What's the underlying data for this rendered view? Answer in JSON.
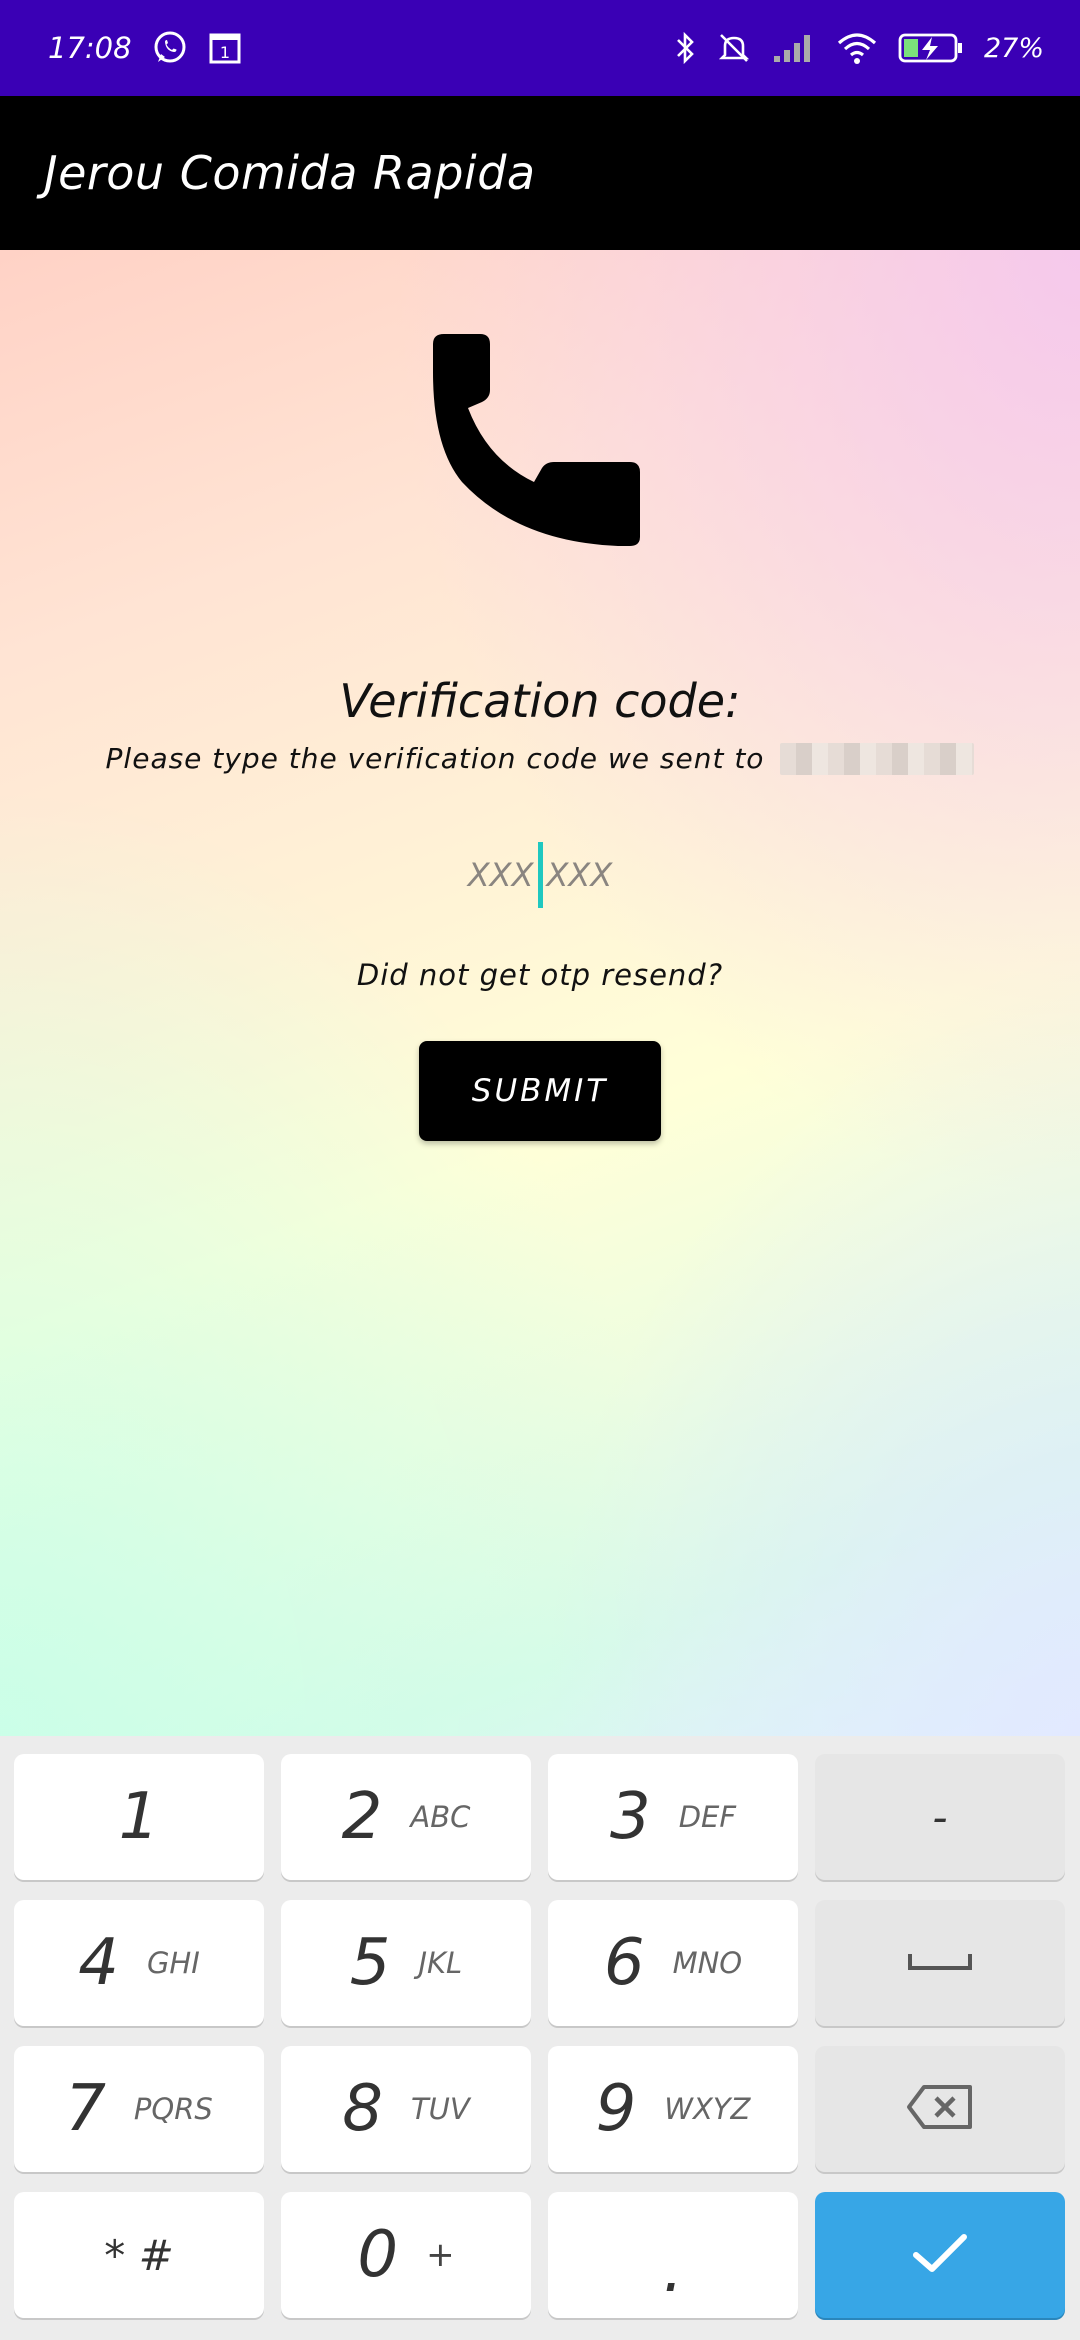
{
  "status_bar": {
    "time": "17:08",
    "battery": "27%",
    "icons": [
      "whatsapp-icon",
      "calendar-icon",
      "bluetooth-icon",
      "mute-icon",
      "signal-icon",
      "wifi-icon",
      "battery-charging-icon"
    ]
  },
  "app_bar": {
    "title": "Jerou Comida Rapida"
  },
  "main": {
    "icon": "phone-icon",
    "title": "Verification code:",
    "subtitle": "Please type the verification code we sent to",
    "otp": {
      "left": "XXX",
      "right": "XXX"
    },
    "resend": "Did not get otp resend?",
    "submit": "SUBMIT"
  },
  "keyboard": {
    "rows": [
      [
        {
          "digit": "1",
          "letters": ""
        },
        {
          "digit": "2",
          "letters": "ABC"
        },
        {
          "digit": "3",
          "letters": "DEF"
        },
        {
          "symbol": "-"
        }
      ],
      [
        {
          "digit": "4",
          "letters": "GHI"
        },
        {
          "digit": "5",
          "letters": "JKL"
        },
        {
          "digit": "6",
          "letters": "MNO"
        },
        {
          "symbol": "space"
        }
      ],
      [
        {
          "digit": "7",
          "letters": "PQRS"
        },
        {
          "digit": "8",
          "letters": "TUV"
        },
        {
          "digit": "9",
          "letters": "WXYZ"
        },
        {
          "symbol": "backspace"
        }
      ],
      [
        {
          "digit": "* #",
          "letters": ""
        },
        {
          "digit": "0",
          "letters": "+"
        },
        {
          "digit": ".",
          "letters": ""
        },
        {
          "symbol": "done"
        }
      ]
    ],
    "accent_color": "#37a6e6"
  },
  "colors": {
    "status_bar": "#3a00b5",
    "app_bar": "#000000",
    "caret": "#1fc8c0"
  }
}
